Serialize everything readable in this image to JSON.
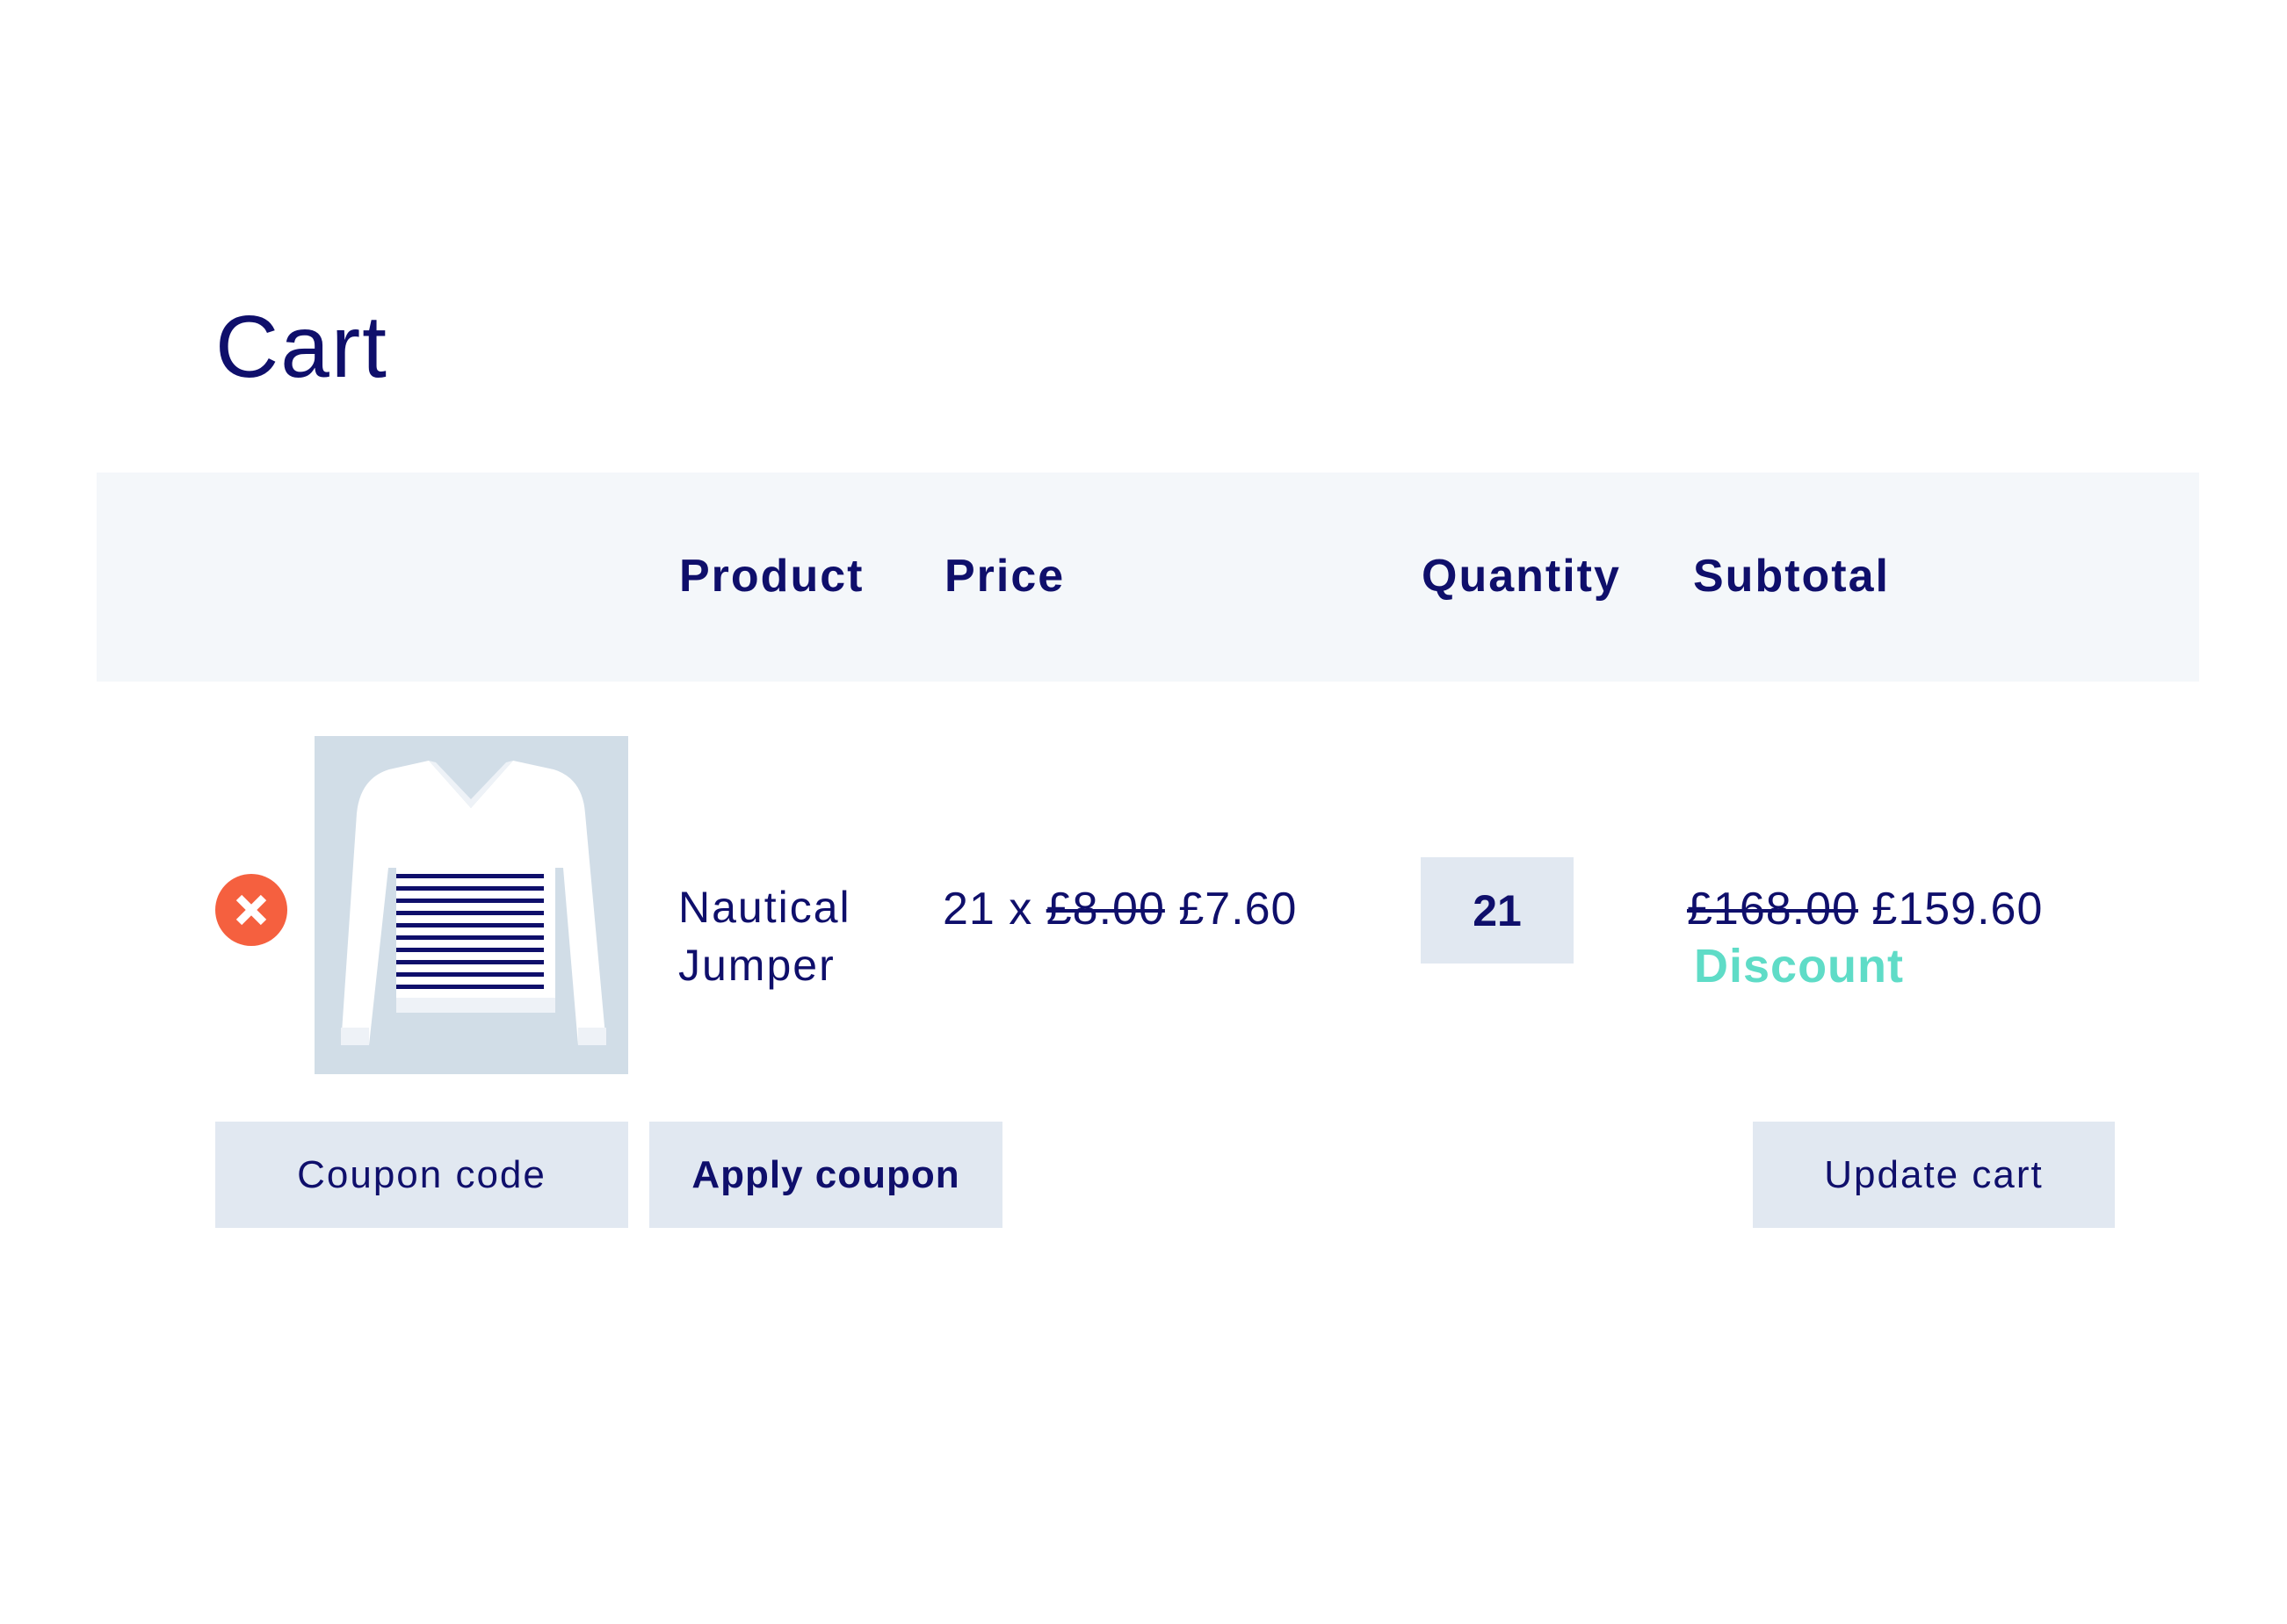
{
  "page": {
    "title": "Cart"
  },
  "table": {
    "headers": {
      "product": "Product",
      "price": "Price",
      "quantity": "Quantity",
      "subtotal": "Subtotal"
    }
  },
  "cart_item": {
    "remove_icon": "close-circle-icon",
    "image_icon": "striped-jumper-image",
    "name_line1": "Nautical",
    "name_line2": "Jumper",
    "price_prefix": "21 x",
    "original_price": "£8.00",
    "discounted_price": "£7.60",
    "quantity": "21",
    "original_subtotal": "£168.00",
    "discounted_subtotal": "£159.60",
    "discount_label": "Discount"
  },
  "actions": {
    "coupon_placeholder": "Coupon code",
    "apply_coupon_label": "Apply coupon",
    "update_cart_label": "Update cart"
  },
  "colors": {
    "text": "#0f0f6b",
    "header_bg": "#f4f7fa",
    "button_bg": "#e1e8f1",
    "remove_red": "#f5603f",
    "discount_teal": "#5fdcc7",
    "image_bg": "#d1dde7"
  }
}
